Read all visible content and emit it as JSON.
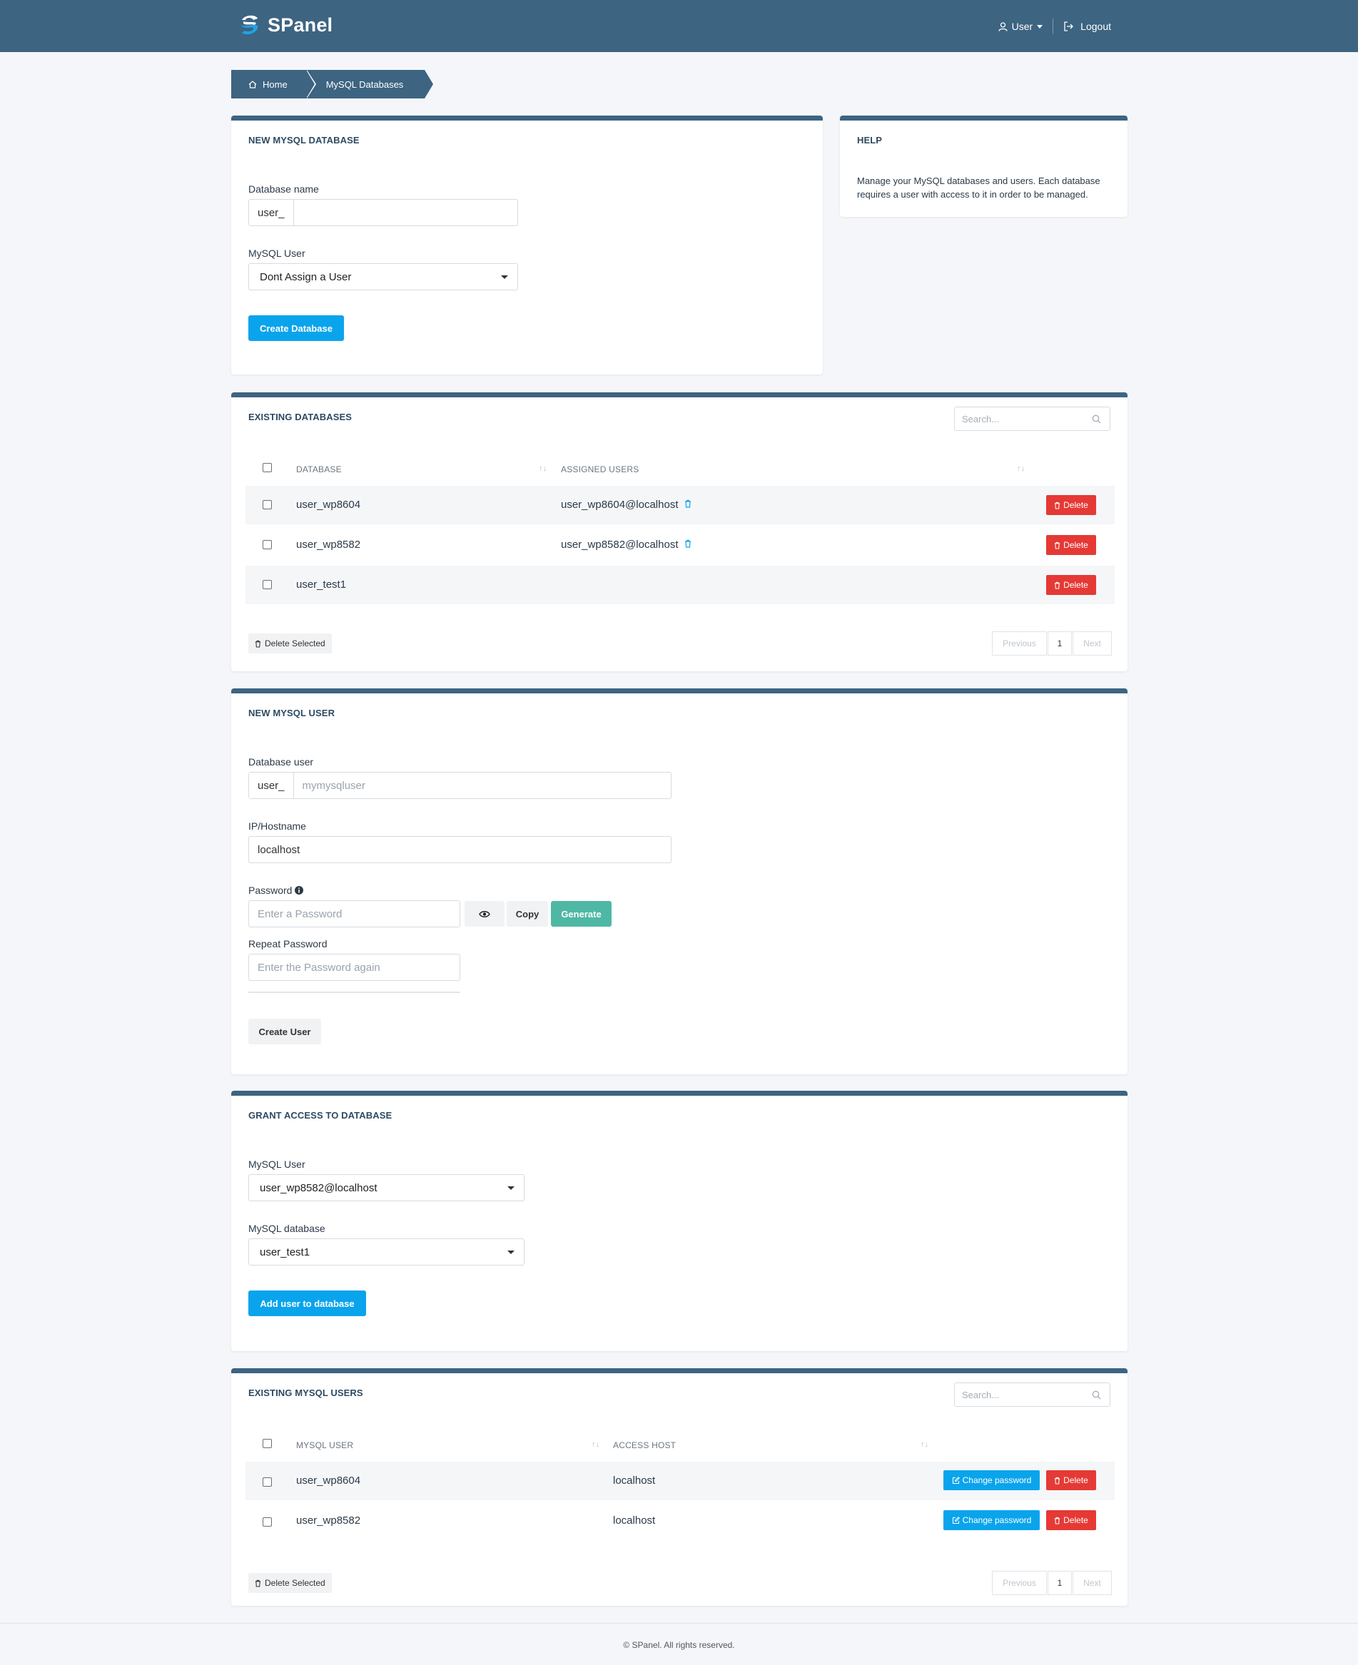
{
  "header": {
    "app_name": "SPanel",
    "user_menu": "User",
    "logout": "Logout"
  },
  "breadcrumb": {
    "home": "Home",
    "current": "MySQL Databases"
  },
  "new_database": {
    "title": "NEW MYSQL DATABASE",
    "name_label": "Database name",
    "name_prefix": "user_",
    "name_value": "",
    "user_label": "MySQL User",
    "user_selected": "Dont Assign a User",
    "create_button": "Create Database"
  },
  "help": {
    "title": "HELP",
    "line1": "Manage your MySQL databases and users. Each database",
    "line2": "requires a user with access to it in order to be managed."
  },
  "existing_databases": {
    "title": "EXISTING DATABASES",
    "search_placeholder": "Search...",
    "columns": [
      "DATABASE",
      "ASSIGNED USERS"
    ],
    "rows": [
      {
        "database": "user_wp8604",
        "assigned": "user_wp8604@localhost",
        "delete": "Delete"
      },
      {
        "database": "user_wp8582",
        "assigned": "user_wp8582@localhost",
        "delete": "Delete"
      },
      {
        "database": "user_test1",
        "assigned": "",
        "delete": "Delete"
      }
    ],
    "delete_selected": "Delete Selected",
    "pager": {
      "previous": "Previous",
      "page": "1",
      "next": "Next"
    }
  },
  "new_user": {
    "title": "NEW MYSQL USER",
    "user_label": "Database user",
    "user_prefix": "user_",
    "user_placeholder": "mymysqluser",
    "host_label": "IP/Hostname",
    "host_value": "localhost",
    "password_label": "Password",
    "password_placeholder": "Enter a Password",
    "copy_button": "Copy",
    "generate_button": "Generate",
    "repeat_label": "Repeat Password",
    "repeat_placeholder": "Enter the Password again",
    "create_button": "Create User"
  },
  "grant_access": {
    "title": "GRANT ACCESS TO DATABASE",
    "user_label": "MySQL User",
    "user_selected": "user_wp8582@localhost",
    "db_label": "MySQL database",
    "db_selected": "user_test1",
    "add_button": "Add user to database"
  },
  "existing_users": {
    "title": "EXISTING MYSQL USERS",
    "search_placeholder": "Search...",
    "columns": [
      "MYSQL USER",
      "ACCESS HOST"
    ],
    "rows": [
      {
        "user": "user_wp8604",
        "host": "localhost",
        "change_password": "Change password",
        "delete": "Delete"
      },
      {
        "user": "user_wp8582",
        "host": "localhost",
        "change_password": "Change password",
        "delete": "Delete"
      }
    ],
    "delete_selected": "Delete Selected",
    "pager": {
      "previous": "Previous",
      "page": "1",
      "next": "Next"
    }
  },
  "footer": {
    "copyright": "© SPanel. All rights reserved."
  },
  "colors": {
    "header": "#3d6481",
    "primary": "#0aa4ec",
    "danger": "#e53935",
    "teal": "#4fb8a5"
  }
}
